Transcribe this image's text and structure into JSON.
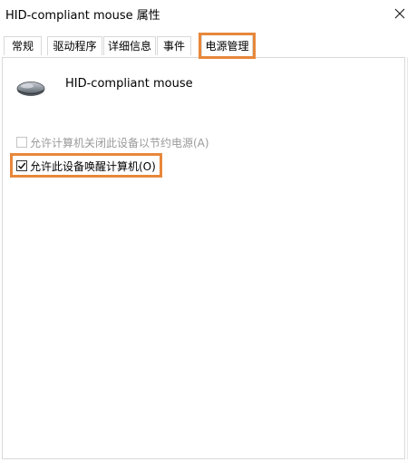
{
  "window": {
    "title": "HID-compliant mouse 属性"
  },
  "tabs": [
    {
      "label": "常规"
    },
    {
      "label": "驱动程序"
    },
    {
      "label": "详细信息"
    },
    {
      "label": "事件"
    },
    {
      "label": "电源管理",
      "active": true
    }
  ],
  "device": {
    "name": "HID-compliant mouse",
    "icon": "mouse-icon"
  },
  "options": [
    {
      "label": "允许计算机关闭此设备以节约电源(A)",
      "checked": false,
      "enabled": false
    },
    {
      "label": "允许此设备唤醒计算机(O)",
      "checked": true,
      "enabled": true
    }
  ],
  "colors": {
    "highlight": "#e8873a",
    "border": "#d9d9d9",
    "disabled_text": "#9a9a9a"
  }
}
